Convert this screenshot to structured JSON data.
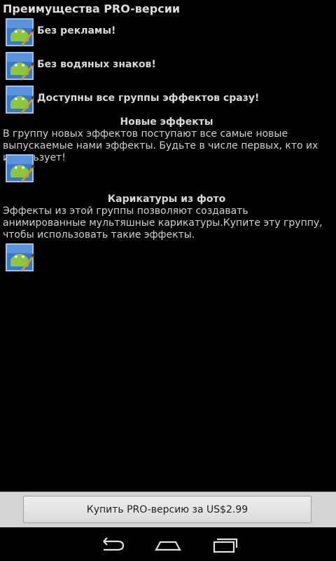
{
  "header": {
    "title": "Преимущества PRO-версии"
  },
  "features": [
    {
      "label": "Без рекламы!"
    },
    {
      "label": "Без водяных знаков!"
    },
    {
      "label": "Доступны все группы эффектов сразу!"
    }
  ],
  "sections": [
    {
      "heading": "Новые эффекты",
      "description": "В группу новых эффектов поступают все самые новые выпускаемые нами эффекты. Будьте в числе первых, кто их использует!"
    },
    {
      "heading": "Карикатуры из фото",
      "description": "Эффекты из этой группы позволяют создавать анимированные мультяшные карикатуры.Купите эту группу, чтобы использовать такие эффекты."
    }
  ],
  "purchase": {
    "button_label": "Купить PRO-версию за US$2.99"
  },
  "nav": {
    "icons": [
      "back-icon",
      "home-icon",
      "recent-apps-icon"
    ]
  },
  "colors": {
    "background": "#000000",
    "icon_blue": "#3a78c9",
    "icon_green": "#8dc63f",
    "button_bar": "#d4d4d4"
  }
}
